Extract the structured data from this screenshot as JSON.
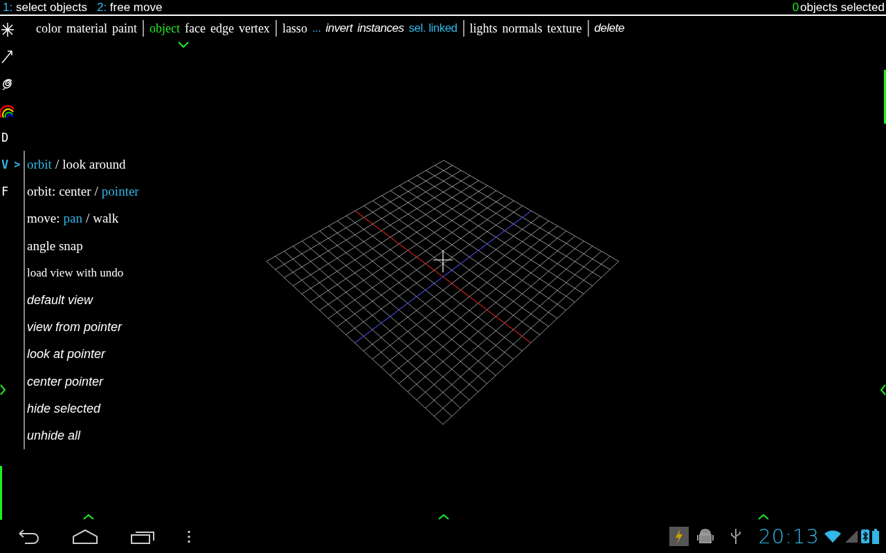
{
  "top_bar": {
    "hints": [
      {
        "key": "1:",
        "label": "select objects"
      },
      {
        "key": "2:",
        "label": "free move"
      }
    ],
    "selection": {
      "count": "0",
      "label": "objects selected"
    }
  },
  "toolbar": {
    "groups": [
      [
        {
          "label": "color",
          "kind": "serif",
          "selected": false
        },
        {
          "label": "material",
          "kind": "serif",
          "selected": false
        },
        {
          "label": "paint",
          "kind": "serif",
          "selected": false
        }
      ],
      [
        {
          "label": "object",
          "kind": "serif",
          "selected": true
        },
        {
          "label": "face",
          "kind": "serif",
          "selected": false
        },
        {
          "label": "edge",
          "kind": "serif",
          "selected": false
        },
        {
          "label": "vertex",
          "kind": "serif",
          "selected": false
        }
      ],
      [
        {
          "label": "lasso",
          "kind": "serif",
          "selected": false
        },
        {
          "label": "...",
          "kind": "link",
          "selected": false
        },
        {
          "label": "invert",
          "kind": "italic",
          "selected": false
        },
        {
          "label": "instances",
          "kind": "italic",
          "selected": false
        },
        {
          "label": "sel. linked",
          "kind": "link",
          "selected": false
        }
      ],
      [
        {
          "label": "lights",
          "kind": "serif",
          "selected": false
        },
        {
          "label": "normals",
          "kind": "serif",
          "selected": false
        },
        {
          "label": "texture",
          "kind": "serif",
          "selected": false
        }
      ],
      [
        {
          "label": "delete",
          "kind": "italic",
          "selected": false
        }
      ]
    ]
  },
  "mode_letters": [
    {
      "label": "D",
      "selected": false
    },
    {
      "label": "V",
      "selected": true
    },
    {
      "label": "F",
      "selected": false
    }
  ],
  "mode_pointer": ">",
  "view_menu": [
    {
      "kind": "toggle",
      "separator": "/",
      "options": [
        {
          "label": "orbit",
          "selected": true
        },
        {
          "label": "look around",
          "selected": false
        }
      ]
    },
    {
      "kind": "toggle",
      "prefix": "orbit:",
      "separator": "/",
      "options": [
        {
          "label": "center",
          "selected": false
        },
        {
          "label": "pointer",
          "selected": true
        }
      ]
    },
    {
      "kind": "toggle",
      "prefix": "move:",
      "separator": "/",
      "options": [
        {
          "label": "pan",
          "selected": true
        },
        {
          "label": "walk",
          "selected": false
        }
      ]
    },
    {
      "kind": "option",
      "label": "angle snap"
    },
    {
      "kind": "small",
      "label": "load view with undo"
    },
    {
      "kind": "action",
      "label": "default view"
    },
    {
      "kind": "action",
      "label": "view from pointer"
    },
    {
      "kind": "action",
      "label": "look at pointer"
    },
    {
      "kind": "action",
      "label": "center pointer"
    },
    {
      "kind": "action",
      "label": "hide selected"
    },
    {
      "kind": "action",
      "label": "unhide all"
    }
  ],
  "status_bar": {
    "time": "20:13"
  }
}
